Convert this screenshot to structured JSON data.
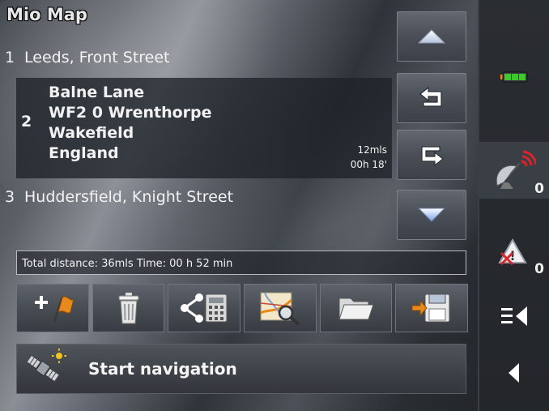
{
  "app": {
    "title": "Mio Map"
  },
  "route": {
    "item1": {
      "num": "1",
      "text": "Leeds, Front Street"
    },
    "item2": {
      "num": "2",
      "lines": [
        "Balne Lane",
        "WF2 0 Wrenthorpe",
        "Wakefield",
        "England"
      ],
      "distance": "12mls",
      "time": "00h 18'"
    },
    "item3": {
      "num": "3",
      "text": "Huddersfield, Knight Street"
    }
  },
  "summary": "Total distance: 36mls Time: 00 h 52 min",
  "start": {
    "label": "Start navigation"
  },
  "sidebar": {
    "battery_level": 1.0,
    "satellite_count": "0",
    "alert_count": "0"
  },
  "colors": {
    "accent_orange": "#e8891e",
    "battery_green": "#3fc82e",
    "battery_orange": "#f08a1c",
    "signal_red": "#d8242a",
    "arrow_blue": "#3a6fd8"
  }
}
